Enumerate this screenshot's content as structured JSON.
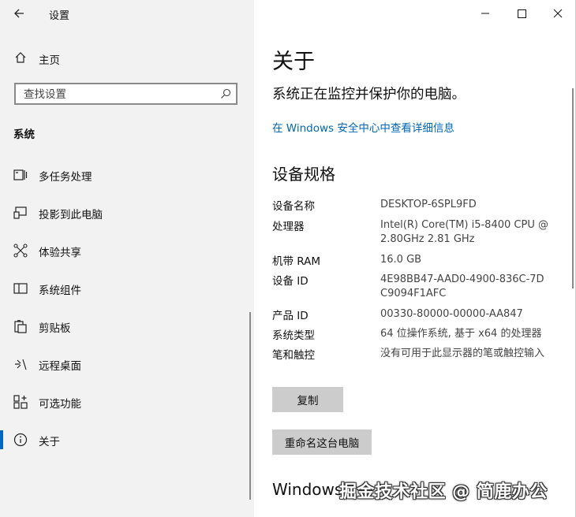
{
  "window": {
    "title": "设置",
    "controls": {
      "minimize": "minimize",
      "maximize": "maximize",
      "close": "close"
    }
  },
  "sidebar": {
    "home_label": "主页",
    "search_placeholder": "查找设置",
    "section_title": "系统",
    "items": [
      {
        "label": "多任务处理",
        "icon": "multitasking-icon",
        "active": false
      },
      {
        "label": "投影到此电脑",
        "icon": "project-icon",
        "active": false
      },
      {
        "label": "体验共享",
        "icon": "share-icon",
        "active": false
      },
      {
        "label": "系统组件",
        "icon": "components-icon",
        "active": false
      },
      {
        "label": "剪贴板",
        "icon": "clipboard-icon",
        "active": false
      },
      {
        "label": "远程桌面",
        "icon": "remote-desktop-icon",
        "active": false
      },
      {
        "label": "可选功能",
        "icon": "optional-features-icon",
        "active": false
      },
      {
        "label": "关于",
        "icon": "info-icon",
        "active": true
      }
    ]
  },
  "main": {
    "title": "关于",
    "subtitle": "系统正在监控并保护你的电脑。",
    "link": "在 Windows 安全中心中查看详细信息",
    "specs_title": "设备规格",
    "specs": [
      {
        "key": "设备名称",
        "value": "DESKTOP-6SPL9FD"
      },
      {
        "key": "处理器",
        "value": "Intel(R) Core(TM) i5-8400 CPU @ 2.80GHz   2.81 GHz"
      },
      {
        "key": "机带 RAM",
        "value": "16.0 GB"
      },
      {
        "key": "设备 ID",
        "value": "4E98BB47-AAD0-4900-836C-7DC9094F1AFC"
      },
      {
        "key": "产品 ID",
        "value": "00330-80000-00000-AA847"
      },
      {
        "key": "系统类型",
        "value": "64 位操作系统, 基于 x64 的处理器"
      },
      {
        "key": "笔和触控",
        "value": "没有可用于此显示器的笔或触控输入"
      }
    ],
    "copy_button": "复制",
    "rename_button": "重命名这台电脑",
    "windows_heading": "Windows"
  },
  "watermark": "掘金技术社区 @ 简鹿办公",
  "colors": {
    "accent": "#0067c0",
    "link": "#0066b4",
    "sidebar_bg": "#f2f2f2",
    "button_bg": "#cccccc"
  }
}
